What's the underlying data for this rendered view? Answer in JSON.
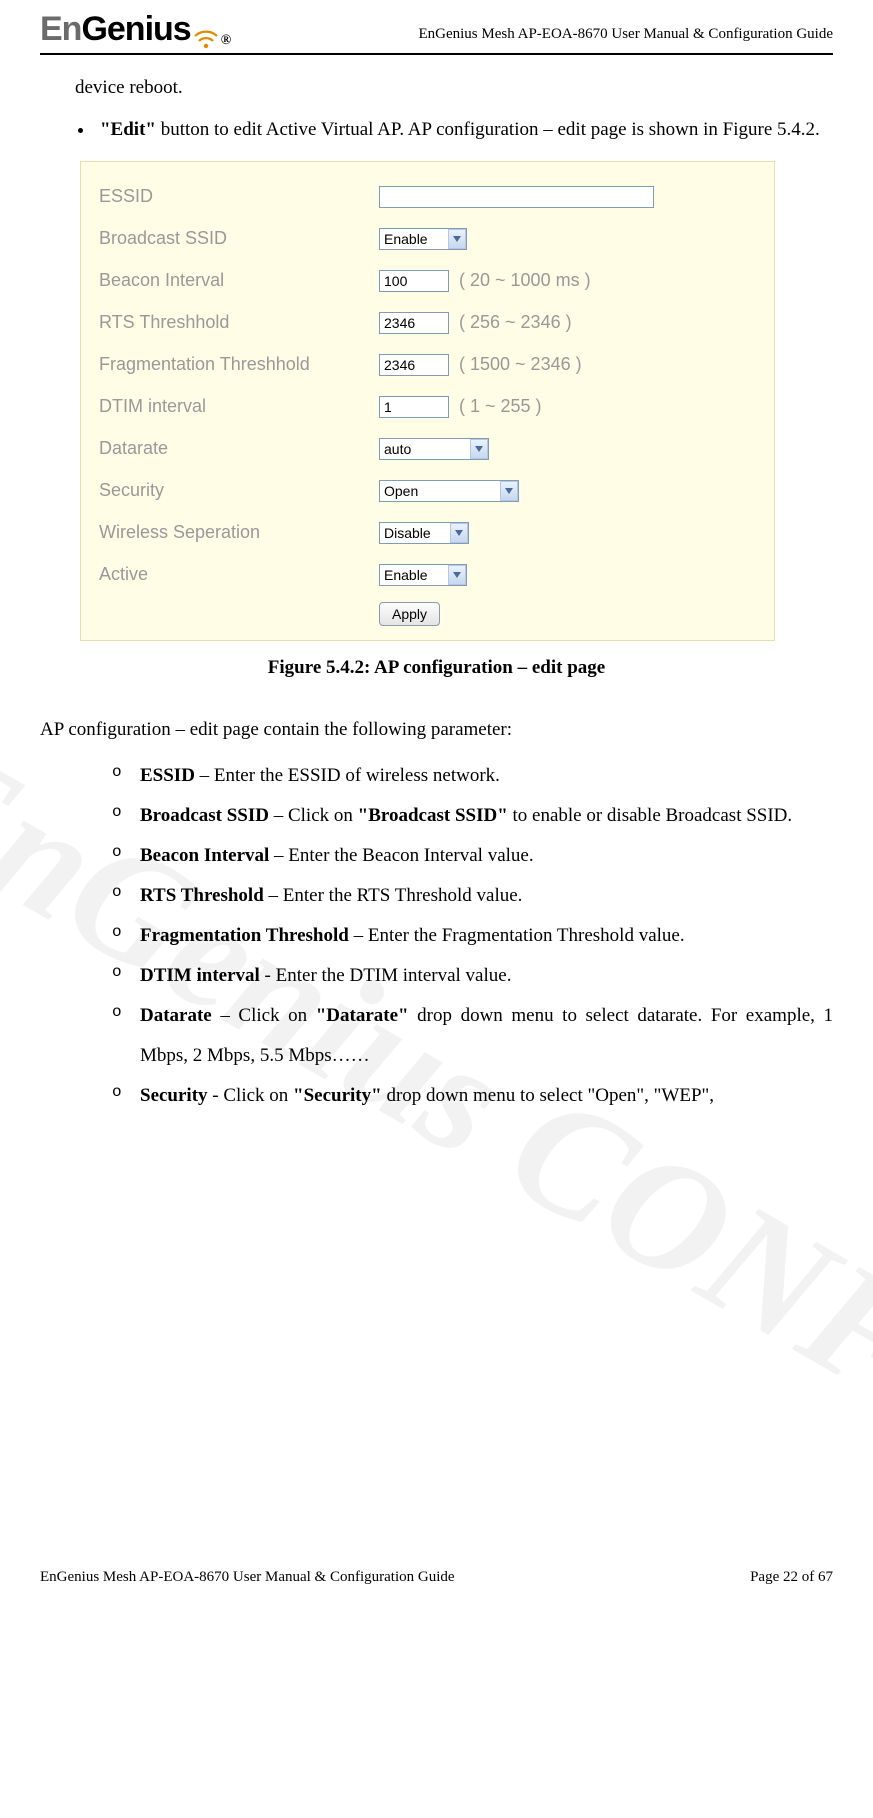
{
  "header": {
    "logo_en": "En",
    "logo_genius": "Genius",
    "logo_reg": "®",
    "right": "EnGenius Mesh AP-EOA-8670 User Manual & Configuration Guide"
  },
  "watermark": "EnGenius CONFIDENTIAL",
  "top_line": "device reboot.",
  "bullet": {
    "prefix_bold": "\"Edit\"",
    "rest": " button to edit Active Virtual AP. AP configuration – edit page is shown in Figure 5.4.2."
  },
  "config": {
    "rows": [
      {
        "label": "ESSID",
        "type": "text",
        "value": "",
        "width": "w-long"
      },
      {
        "label": "Broadcast SSID",
        "type": "select",
        "value": "Enable",
        "selw": 60
      },
      {
        "label": "Beacon Interval",
        "type": "text",
        "value": "100",
        "width": "w-short",
        "hint": "( 20 ~ 1000 ms )"
      },
      {
        "label": "RTS Threshhold",
        "type": "text",
        "value": "2346",
        "width": "w-short",
        "hint": "( 256 ~ 2346 )"
      },
      {
        "label": "Fragmentation Threshhold",
        "type": "text",
        "value": "2346",
        "width": "w-short",
        "hint": "( 1500 ~ 2346 )"
      },
      {
        "label": "DTIM interval",
        "type": "text",
        "value": "1",
        "width": "w-short",
        "hint": "( 1 ~ 255 )"
      },
      {
        "label": "Datarate",
        "type": "select",
        "value": "auto",
        "selw": 82
      },
      {
        "label": "Security",
        "type": "select",
        "value": "Open",
        "selw": 112
      },
      {
        "label": "Wireless Seperation",
        "type": "select",
        "value": "Disable",
        "selw": 62
      },
      {
        "label": "Active",
        "type": "select",
        "value": "Enable",
        "selw": 60
      }
    ],
    "apply": "Apply"
  },
  "figure_caption": "Figure 5.4.2: AP configuration – edit page",
  "para_after": "AP configuration – edit page contain the following parameter:",
  "olist": [
    {
      "b": "ESSID",
      "t": " – Enter the ESSID of wireless network."
    },
    {
      "b": "Broadcast SSID",
      "t": " – Click on ",
      "b2": "\"Broadcast SSID\"",
      "t2": " to enable or disable Broadcast SSID."
    },
    {
      "b": "Beacon Interval",
      "t": " – Enter the Beacon Interval value."
    },
    {
      "b": "RTS Threshold",
      "t": " – Enter the RTS Threshold value."
    },
    {
      "b": "Fragmentation Threshold",
      "t": " – Enter the Fragmentation Threshold value."
    },
    {
      "b": "DTIM interval",
      "t": " - Enter the DTIM interval value."
    },
    {
      "b": "Datarate",
      "t": " – Click on ",
      "b2": "\"Datarate\"",
      "t2": " drop down menu to select datarate. For example, 1 Mbps, 2 Mbps, 5.5 Mbps……"
    },
    {
      "b": "Security",
      "t": " - Click on ",
      "b2": "\"Security\"",
      "t2": " drop down menu to select \"Open\", \"WEP\","
    }
  ],
  "footer": {
    "left": "EnGenius Mesh AP-EOA-8670 User Manual & Configuration Guide",
    "right": "Page 22 of 67"
  }
}
